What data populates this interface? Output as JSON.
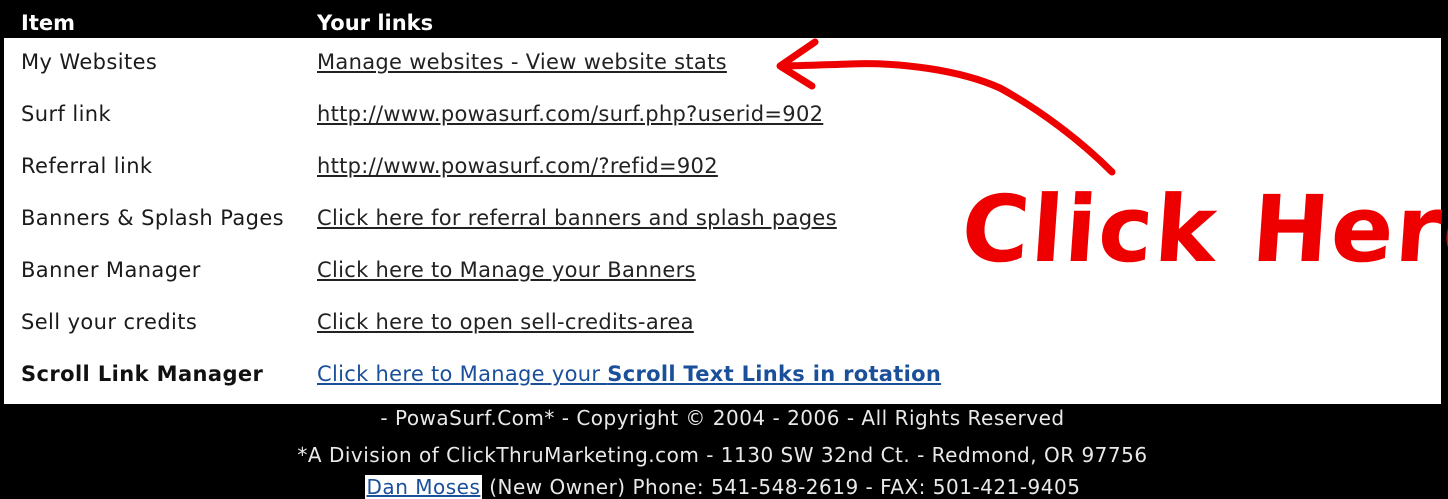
{
  "table": {
    "header": {
      "item": "Item",
      "links": "Your links"
    },
    "rows": [
      {
        "item": "My Websites",
        "link": "Manage websites - View website stats"
      },
      {
        "item": "Surf link",
        "link": "http://www.powasurf.com/surf.php?userid=902"
      },
      {
        "item": "Referral link",
        "link": "http://www.powasurf.com/?refid=902"
      },
      {
        "item": "Banners & Splash Pages",
        "link": "Click here for referral banners and splash pages"
      },
      {
        "item": "Banner Manager",
        "link": "Click here to Manage your Banners"
      },
      {
        "item": "Sell your credits",
        "link": "Click here to open sell-credits-area"
      },
      {
        "item": "Scroll Link Manager",
        "link_prefix": "Click here to Manage your ",
        "link_bold": "Scroll Text Links in rotation"
      }
    ]
  },
  "footer": {
    "copyright": "- PowaSurf.Com* - Copyright © 2004 - 2006 - All Rights Reserved",
    "division": "*A Division of ClickThruMarketing.com - 1130 SW 32nd Ct. - Redmond, OR 97756",
    "owner_name": "Dan Moses",
    "owner_details": " (New Owner) Phone: 541-548-2619 - FAX: 501-421-9405"
  },
  "annotation": {
    "text": "Click Here",
    "color": "#ee0000"
  },
  "colors": {
    "header_bg": "#000000",
    "link_blue": "#1a4f9a"
  }
}
